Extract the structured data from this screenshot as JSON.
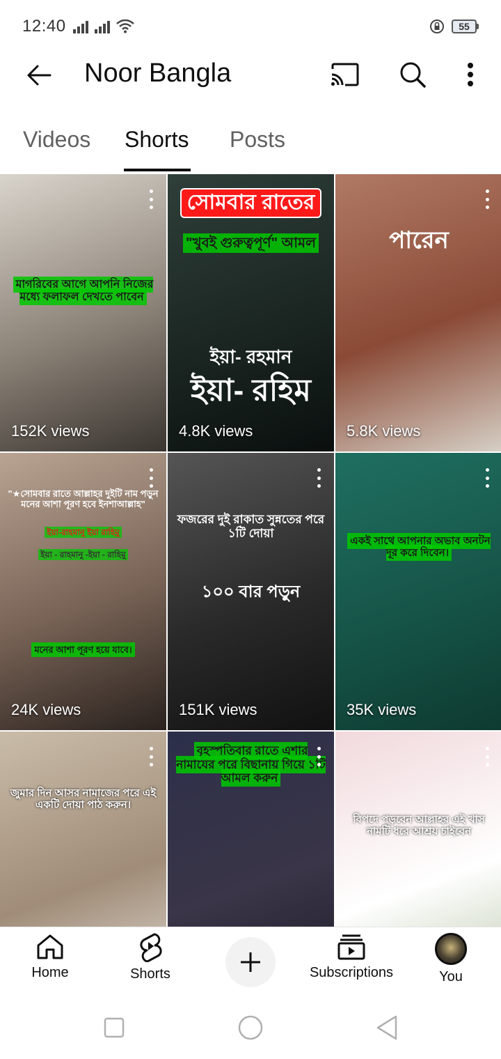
{
  "status_bar": {
    "time": "12:40",
    "battery_level": "55"
  },
  "app_bar": {
    "channel_name": "Noor Bangla",
    "icons": [
      "arrow-back-icon",
      "cast-icon",
      "search-icon",
      "more-vert-icon"
    ]
  },
  "tabs": [
    {
      "label": "Videos",
      "active": false
    },
    {
      "label": "Shorts",
      "active": true
    },
    {
      "label": "Posts",
      "active": false
    }
  ],
  "shorts": [
    {
      "views": "152K views",
      "overlay": "মাগরিবের আগে আপনি নিজের মধ্যে ফলাফল দেখতে পাবেন",
      "bg": [
        "#d9d4cc",
        "#8c8378",
        "#3a3530"
      ]
    },
    {
      "views": "4.8K views",
      "overlay_top": "সোমবার রাতের",
      "overlay_mid": "\"খুবই গুরুত্বপূর্ণ\" আমল",
      "overlay_sub": "ইয়া- রহমান",
      "overlay_main": "ইয়া- রহিম",
      "bg": [
        "#2f3f3a",
        "#1b2622",
        "#0a0f0e"
      ]
    },
    {
      "views": "5.8K views",
      "overlay": "পারেন",
      "bg": [
        "#b07a64",
        "#8a4a36",
        "#d6cfc5"
      ]
    },
    {
      "views": "24K views",
      "overlay": "\"★সোমবার রাতে আল্লাহর দুইটি নাম পড়ুন মনের আশা পূরণ হবে ইনশাআল্লাহ\"",
      "overlay_line1": "ইয়া-রাহমানু ইয়া রাহিমু",
      "overlay_line2": "ইয়া - রাহমানু -ইয়া - রাহিমু",
      "overlay_bottom": "মনের আশা পূরণ হয়ে যাবে।",
      "bg": [
        "#b9a493",
        "#776255",
        "#2a221e"
      ]
    },
    {
      "views": "151K views",
      "overlay": "ফজরের দুই রাকাত সুন্নতের পরে ১টি দোয়া",
      "overlay_main": "১০০ বার পড়ুন",
      "bg": [
        "#555555",
        "#2a2a2a",
        "#111111"
      ]
    },
    {
      "views": "35K views",
      "overlay": "একই সাথে আপনার অভাব অনটন দূর করে দিবেন।",
      "bg": [
        "#1f6f61",
        "#165548",
        "#0e3a31"
      ]
    },
    {
      "views": "",
      "overlay": "জুমার দিন আসর নামাজের পরে এই একটি দোয়া পাঠ করুন।",
      "bg": [
        "#c9bca9",
        "#a08c78",
        "#e6e1da"
      ]
    },
    {
      "views": "",
      "overlay": "বৃহস্পতিবার রাতে এশার নামাযের পরে বিছানায় গিয়ে ১টি আমল করুন",
      "bg": [
        "#2c2f4a",
        "#3a3548",
        "#1b1a26"
      ]
    },
    {
      "views": "",
      "overlay": "বিপদে পড়বেন আল্লাহর এই খাস নামটি ধরে আশ্রয় চাইবেন",
      "bg": [
        "#f1d9dc",
        "#ffffff",
        "#b4c4a4"
      ]
    }
  ],
  "bottom_nav": {
    "home": "Home",
    "shorts": "Shorts",
    "subscriptions": "Subscriptions",
    "you": "You"
  },
  "colors": {
    "accent": "#0f0f0f",
    "muted": "#606060",
    "green_label": "#00c800"
  }
}
